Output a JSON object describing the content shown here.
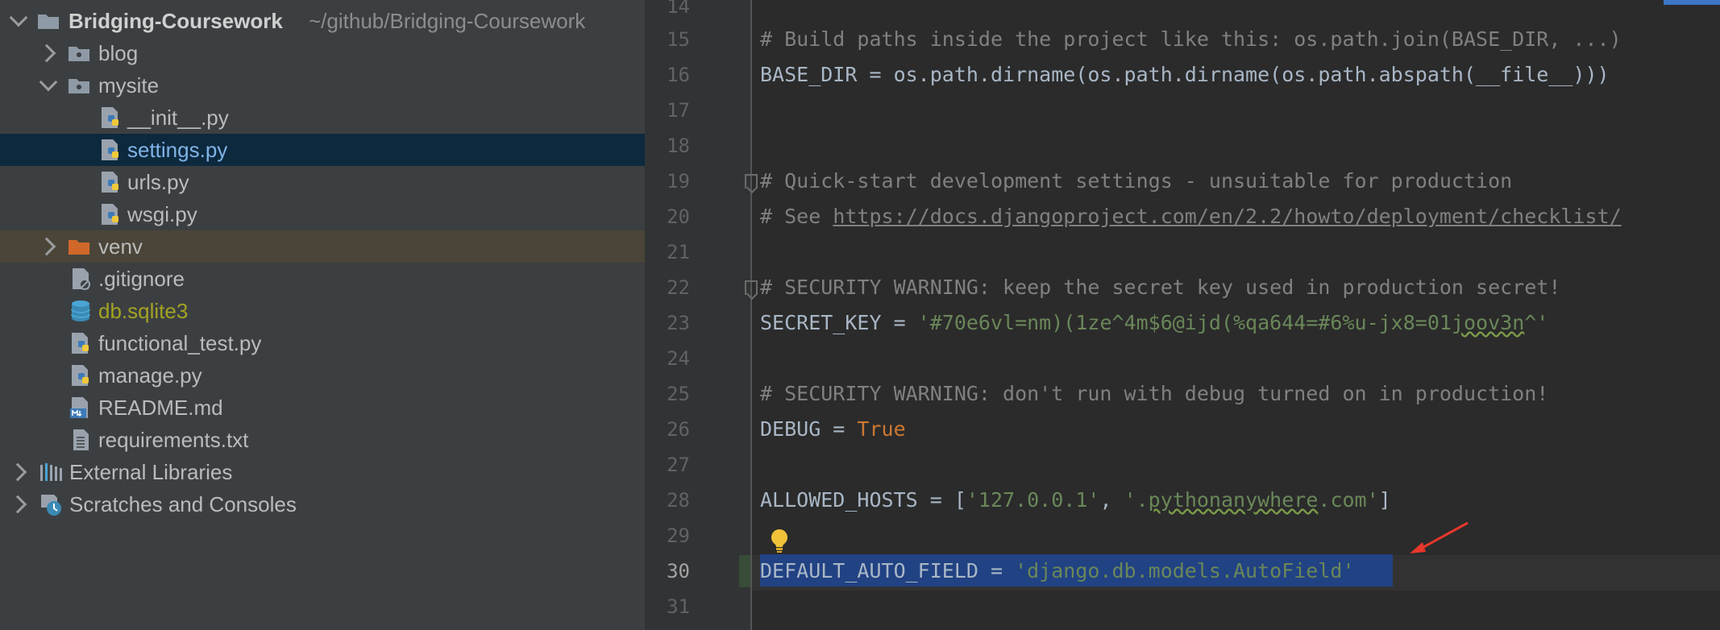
{
  "tree": {
    "root": {
      "name": "Bridging-Coursework",
      "path": "~/github/Bridging-Coursework",
      "icon": "folder-icon"
    },
    "items": [
      {
        "label": "blog",
        "icon": "package-folder-icon"
      },
      {
        "label": "mysite",
        "icon": "package-folder-icon"
      },
      {
        "label": "__init__.py",
        "icon": "python-file-icon"
      },
      {
        "label": "settings.py",
        "icon": "python-file-icon"
      },
      {
        "label": "urls.py",
        "icon": "python-file-icon"
      },
      {
        "label": "wsgi.py",
        "icon": "python-file-icon"
      },
      {
        "label": "venv",
        "icon": "excluded-folder-icon"
      },
      {
        "label": ".gitignore",
        "icon": "ignored-file-icon"
      },
      {
        "label": "db.sqlite3",
        "icon": "database-icon"
      },
      {
        "label": "functional_test.py",
        "icon": "python-file-icon"
      },
      {
        "label": "manage.py",
        "icon": "python-file-icon"
      },
      {
        "label": "README.md",
        "icon": "markdown-file-icon"
      },
      {
        "label": "requirements.txt",
        "icon": "text-file-icon"
      },
      {
        "label": "External Libraries",
        "icon": "libraries-icon"
      },
      {
        "label": "Scratches and Consoles",
        "icon": "scratches-icon"
      }
    ]
  },
  "editor": {
    "line_numbers": [
      "14",
      "15",
      "16",
      "17",
      "18",
      "19",
      "20",
      "21",
      "22",
      "23",
      "24",
      "25",
      "26",
      "27",
      "28",
      "29",
      "30",
      "31"
    ],
    "current_line": "30",
    "code": {
      "l15": "# Build paths inside the project like this: os.path.join(BASE_DIR, ...)",
      "l16": "BASE_DIR = os.path.dirname(os.path.dirname(os.path.abspath(__file__)))",
      "l19": "# Quick-start development settings - unsuitable for production",
      "l20_prefix": "# See ",
      "l20_url": "https://docs.djangoproject.com/en/2.2/howto/deployment/checklist/",
      "l22": "# SECURITY WARNING: keep the secret key used in production secret!",
      "l23_name": "SECRET_KEY = ",
      "l23_value_a": "'#70e6vl=nm)(1ze^4m$6@ijd(%qa644=#6%u-jx8=01",
      "l23_value_b": "joov3n",
      "l23_value_c": "^'",
      "l25": "# SECURITY WARNING: don't run with debug turned on in production!",
      "l26_name": "DEBUG = ",
      "l26_value": "True",
      "l28_name": "ALLOWED_HOSTS = [",
      "l28_a": "'127.0.0.1'",
      "l28_sep": ", ",
      "l28_b1": "'.",
      "l28_b2": "pythonanywhere",
      "l28_b3": ".com'",
      "l28_end": "]",
      "l30_name": "DEFAULT_AUTO_FIELD = ",
      "l30_value": "'django.db.models.AutoField'"
    },
    "colors": {
      "comment": "#808080",
      "string": "#6a8759",
      "keyword": "#cc7832",
      "selection": "#214283",
      "annotation_arrow": "#e8372c"
    }
  }
}
